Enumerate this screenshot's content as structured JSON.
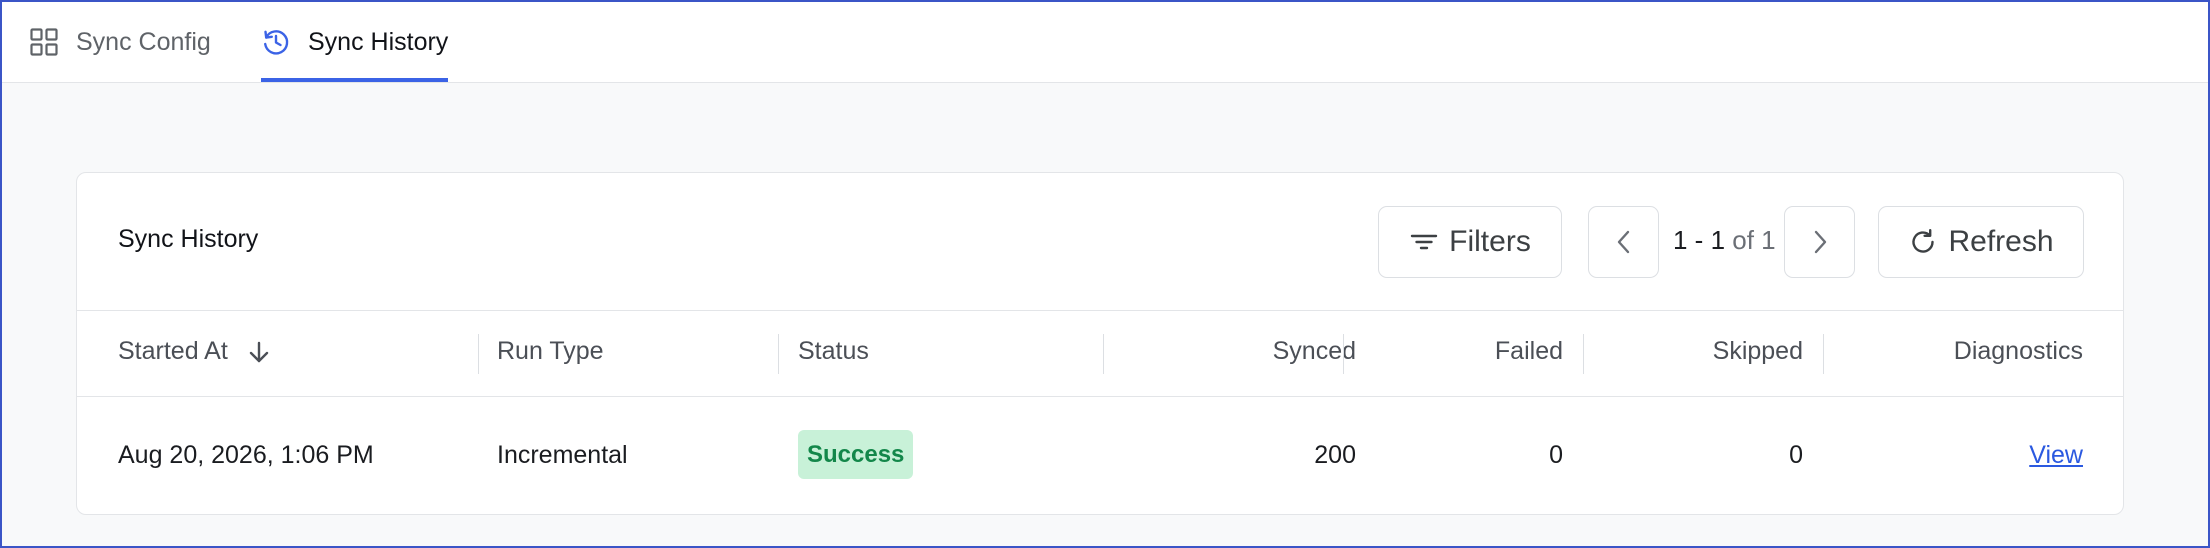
{
  "tabs": [
    {
      "label": "Sync Config",
      "icon": "grid-icon",
      "active": false
    },
    {
      "label": "Sync History",
      "icon": "history-icon",
      "active": true
    }
  ],
  "card": {
    "title": "Sync History",
    "filters_label": "Filters",
    "refresh_label": "Refresh",
    "pager": {
      "range": "1 - 1",
      "of_text": "of 1"
    }
  },
  "table": {
    "columns": [
      "Started At",
      "Run Type",
      "Status",
      "Synced",
      "Failed",
      "Skipped",
      "Diagnostics"
    ],
    "sort_column": "Started At",
    "sort_direction": "descending",
    "rows": [
      {
        "started_at": "Aug 20, 2026, 1:06 PM",
        "run_type": "Incremental",
        "status": "Success",
        "synced": "200",
        "failed": "0",
        "skipped": "0",
        "diagnostics": "View"
      }
    ]
  },
  "colors": {
    "accent": "#3b63e6",
    "success_bg": "#c8f1d8",
    "success_text": "#13874a",
    "link": "#2b59e0"
  }
}
